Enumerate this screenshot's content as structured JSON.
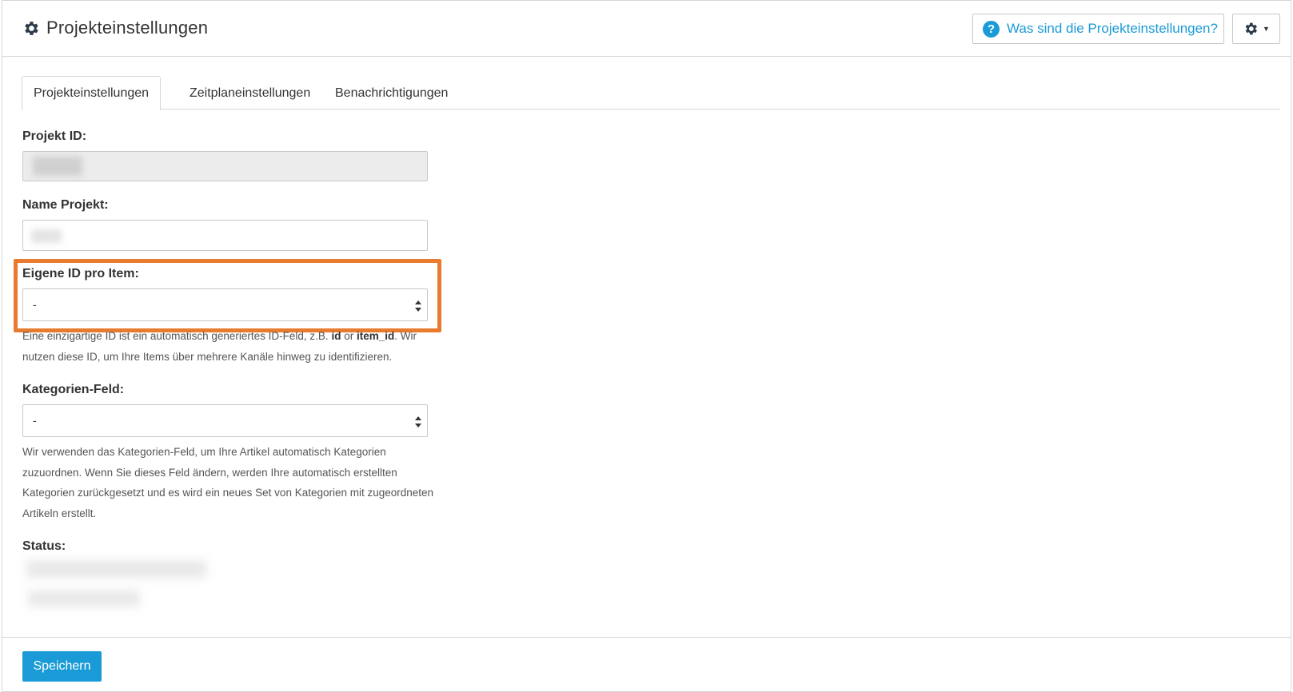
{
  "header": {
    "title": "Projekteinstellungen",
    "title_icon": "gear-icon",
    "help_button_label": "Was sind die Projekteinstellungen?",
    "help_icon": "question-circle-icon",
    "settings_menu_icon": "gear-icon"
  },
  "tabs": [
    {
      "label": "Projekteinstellungen",
      "active": true
    },
    {
      "label": "Zeitplaneinstellungen",
      "active": false
    },
    {
      "label": "Benachrichtigungen",
      "active": false
    }
  ],
  "fields": {
    "project_id": {
      "label": "Projekt ID:",
      "value_blurred": true
    },
    "project_name": {
      "label": "Name Projekt:",
      "value_blurred": true
    },
    "custom_id": {
      "label": "Eigene ID pro Item:",
      "selected": "-",
      "help_before": "Eine einzigartige ID ist ein automatisch generiertes ID-Feld, z.B. ",
      "help_code1": "id",
      "help_or": " or ",
      "help_code2": "item_id",
      "help_after": ". Wir nutzen diese ID, um Ihre Items über mehrere Kanäle hinweg zu identifizieren."
    },
    "category_field": {
      "label": "Kategorien-Feld:",
      "selected": "-",
      "help": "Wir verwenden das Kategorien-Feld, um Ihre Artikel automatisch Kategorien zuzuordnen. Wenn Sie dieses Feld ändern, werden Ihre automatisch erstellten Kategorien zurückgesetzt und es wird ein neues Set von Kategorien mit zugeordneten Artikeln erstellt."
    },
    "status": {
      "label": "Status:",
      "value_blurred": true
    }
  },
  "footer": {
    "save_label": "Speichern"
  },
  "colors": {
    "accent": "#1a9bd7",
    "highlight": "#e87b2d"
  }
}
